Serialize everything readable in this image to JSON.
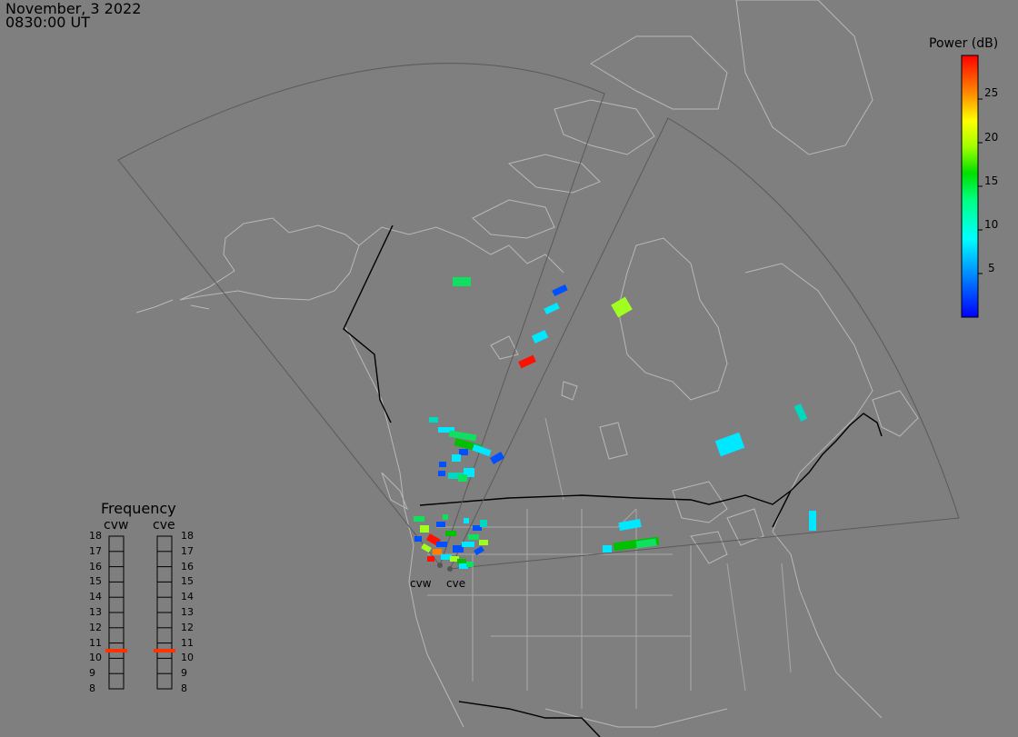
{
  "header": {
    "date": "November, 3 2022",
    "time": "0830:00 UT"
  },
  "colorbar": {
    "title": "Power (dB)",
    "ticks": [
      "25",
      "20",
      "15",
      "10",
      "5"
    ],
    "tick_values": [
      25,
      20,
      15,
      10,
      5
    ],
    "range": [
      0,
      30
    ],
    "colors": [
      "#0000ff",
      "#00a0ff",
      "#00ffff",
      "#00ff80",
      "#00e000",
      "#80ff00",
      "#ffff00",
      "#ffb000",
      "#ff6000",
      "#ff0000"
    ]
  },
  "frequency_panel": {
    "title": "Frequency",
    "radars": [
      {
        "name": "cvw",
        "selected_mhz": 10.5
      },
      {
        "name": "cve",
        "selected_mhz": 10.5
      }
    ],
    "levels": [
      "18",
      "17",
      "16",
      "15",
      "14",
      "13",
      "12",
      "11",
      "10",
      "9",
      "8"
    ],
    "indicator_color": "#ff3300"
  },
  "map": {
    "radar_labels": [
      "cvw",
      "cve"
    ],
    "background": "#7f7f7f",
    "coast_color": "#b8b8b8",
    "border_color": "#000000"
  }
}
